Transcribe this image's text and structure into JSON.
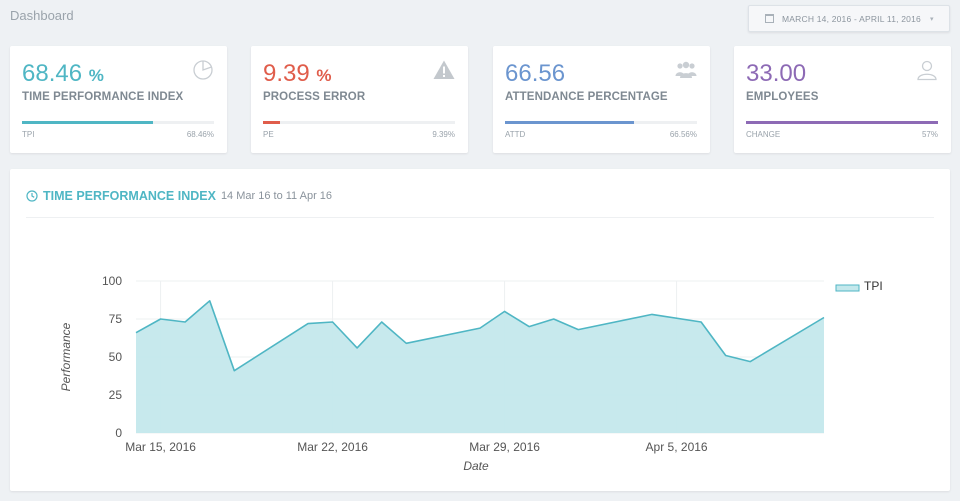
{
  "header": {
    "title": "Dashboard",
    "date_range": "MARCH 14, 2016 - APRIL 11, 2016"
  },
  "cards": [
    {
      "value": "68.46",
      "unit": "%",
      "label": "TIME PERFORMANCE INDEX",
      "foot_left": "TPI",
      "foot_right": "68.46%",
      "progress": 0.68,
      "color": "#4fb6c4",
      "icon": "pie-chart-icon"
    },
    {
      "value": "9.39",
      "unit": "%",
      "label": "PROCESS ERROR",
      "foot_left": "PE",
      "foot_right": "9.39%",
      "progress": 0.09,
      "color": "#e05d4b",
      "icon": "warning-icon"
    },
    {
      "value": "66.56",
      "unit": "",
      "label": "ATTENDANCE PERCENTAGE",
      "foot_left": "ATTD",
      "foot_right": "66.56%",
      "progress": 0.67,
      "color": "#6b95cf",
      "icon": "users-icon"
    },
    {
      "value": "33.00",
      "unit": "",
      "label": "EMPLOYEES",
      "foot_left": "CHANGE",
      "foot_right": "57%",
      "progress": 1.0,
      "color": "#8d6ab5",
      "icon": "user-icon"
    }
  ],
  "chart_panel": {
    "title": "TIME PERFORMANCE INDEX",
    "subtitle": "14 Mar 16 to 11 Apr 16"
  },
  "chart_data": {
    "type": "area",
    "x": [
      "2016-03-14",
      "2016-03-15",
      "2016-03-16",
      "2016-03-17",
      "2016-03-18",
      "2016-03-21",
      "2016-03-22",
      "2016-03-23",
      "2016-03-24",
      "2016-03-25",
      "2016-03-28",
      "2016-03-29",
      "2016-03-30",
      "2016-03-31",
      "2016-04-01",
      "2016-04-04",
      "2016-04-06",
      "2016-04-07",
      "2016-04-08",
      "2016-04-11"
    ],
    "series": [
      {
        "name": "TPI",
        "values": [
          66,
          75,
          73,
          87,
          41,
          72,
          73,
          56,
          73,
          59,
          69,
          80,
          70,
          75,
          68,
          78,
          73,
          51,
          47,
          76
        ]
      }
    ],
    "x_ticks": [
      "Mar 15, 2016",
      "Mar 22, 2016",
      "Mar 29, 2016",
      "Apr 5, 2016"
    ],
    "x_tick_dates": [
      "2016-03-15",
      "2016-03-22",
      "2016-03-29",
      "2016-04-05"
    ],
    "x_range": [
      "2016-03-14",
      "2016-04-11"
    ],
    "y_ticks": [
      "0",
      "25",
      "50",
      "75",
      "100"
    ],
    "ylim": [
      0,
      100
    ],
    "xlabel": "Date",
    "ylabel": "Performance",
    "legend_position": "top-right",
    "grid": true,
    "line_color": "#4fb6c4",
    "fill_color": "#c4e8ec"
  }
}
